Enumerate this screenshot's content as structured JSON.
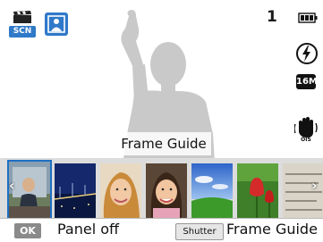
{
  "topbar": {
    "scene_badge": "SCN",
    "shot_count": "1",
    "image_size_badge": "16M"
  },
  "overlay": {
    "frame_guide_label": "Frame Guide"
  },
  "thumbnails": [
    {
      "name": "frame-guide",
      "selected": true
    },
    {
      "name": "night-bridge",
      "selected": false
    },
    {
      "name": "beauty-woman",
      "selected": false
    },
    {
      "name": "child-portrait",
      "selected": false
    },
    {
      "name": "landscape-sky",
      "selected": false
    },
    {
      "name": "red-tulips",
      "selected": false
    },
    {
      "name": "text-page",
      "selected": false
    }
  ],
  "bottom": {
    "ok_key": "OK",
    "ok_action": "Panel off",
    "shutter_key": "Shutter",
    "shutter_action": "Frame Guide"
  },
  "colors": {
    "accent": "#2f79c9",
    "selection": "#1e6fc4"
  }
}
